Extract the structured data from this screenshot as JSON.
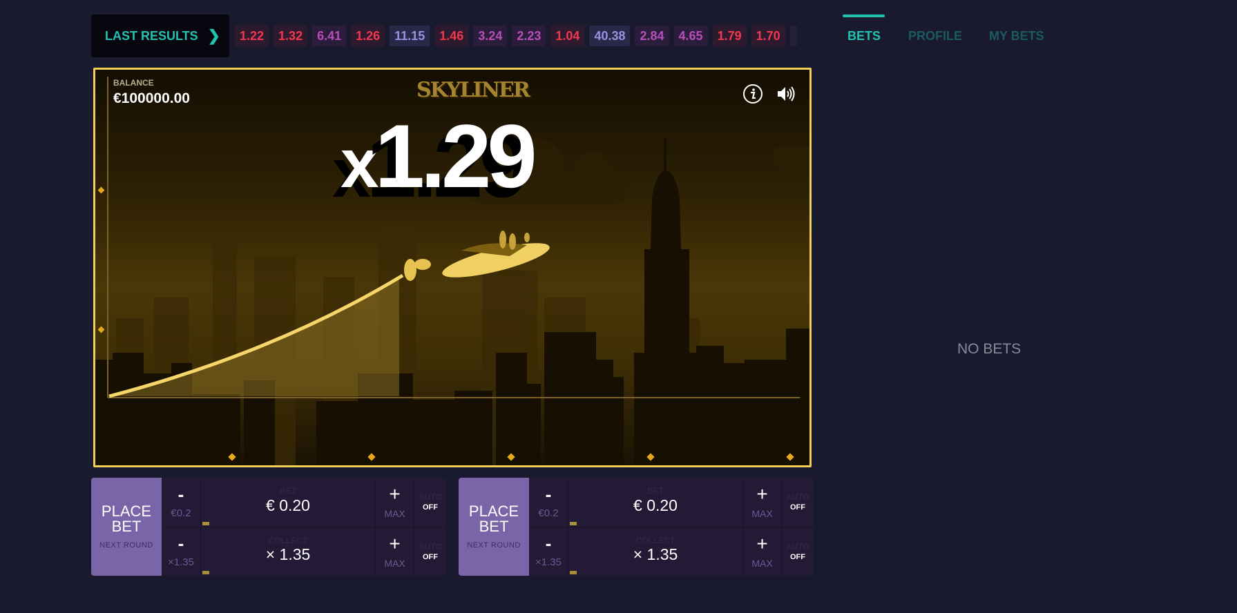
{
  "last_results": {
    "label": "LAST RESULTS",
    "chevron_icon": "chevron-right-icon",
    "values": [
      {
        "value": "1.22",
        "tone": "red"
      },
      {
        "value": "1.32",
        "tone": "red"
      },
      {
        "value": "6.41",
        "tone": "pink"
      },
      {
        "value": "1.26",
        "tone": "red"
      },
      {
        "value": "11.15",
        "tone": "violet"
      },
      {
        "value": "1.46",
        "tone": "red"
      },
      {
        "value": "3.24",
        "tone": "pink"
      },
      {
        "value": "2.23",
        "tone": "pink"
      },
      {
        "value": "1.04",
        "tone": "red"
      },
      {
        "value": "40.38",
        "tone": "violet"
      },
      {
        "value": "2.84",
        "tone": "pink"
      },
      {
        "value": "4.65",
        "tone": "pink"
      },
      {
        "value": "1.79",
        "tone": "red"
      },
      {
        "value": "1.70",
        "tone": "red"
      }
    ]
  },
  "game": {
    "balance_label": "BALANCE",
    "balance_value": "€100000.00",
    "logo_text": "SKYLINER",
    "multiplier_prefix": "x",
    "multiplier_value": "1.29",
    "info_icon": "info-icon",
    "sound_icon": "speaker-icon"
  },
  "bet_panels": [
    {
      "place_label_line1": "PLACE",
      "place_label_line2": "BET",
      "place_sub": "NEXT ROUND",
      "bet_row": {
        "minus": "-",
        "step": "€0.2",
        "label": "BET",
        "value": "€ 0.20",
        "plus": "+",
        "max": "MAX",
        "auto_label": "AUTO",
        "auto_state": "OFF"
      },
      "collect_row": {
        "minus": "-",
        "step": "×1.35",
        "label": "COLLECT",
        "value": "× 1.35",
        "plus": "+",
        "max": "MAX",
        "auto_label": "AUTO",
        "auto_state": "OFF"
      }
    },
    {
      "place_label_line1": "PLACE",
      "place_label_line2": "BET",
      "place_sub": "NEXT ROUND",
      "bet_row": {
        "minus": "-",
        "step": "€0.2",
        "label": "BET",
        "value": "€ 0.20",
        "plus": "+",
        "max": "MAX",
        "auto_label": "AUTO",
        "auto_state": "OFF"
      },
      "collect_row": {
        "minus": "-",
        "step": "×1.35",
        "label": "COLLECT",
        "value": "× 1.35",
        "plus": "+",
        "max": "MAX",
        "auto_label": "AUTO",
        "auto_state": "OFF"
      }
    }
  ],
  "side_panel": {
    "tabs": [
      {
        "label": "BETS",
        "active": true
      },
      {
        "label": "PROFILE",
        "active": false
      },
      {
        "label": "MY BETS",
        "active": false
      }
    ],
    "empty_text": "NO BETS"
  },
  "colors": {
    "accent": "#23c2b0",
    "frame_gold": "#f2cf55",
    "place_bet": "#7a65a8",
    "result_red": "#f2384f",
    "result_pink": "#b84fb6",
    "result_violet": "#9b90e2"
  }
}
